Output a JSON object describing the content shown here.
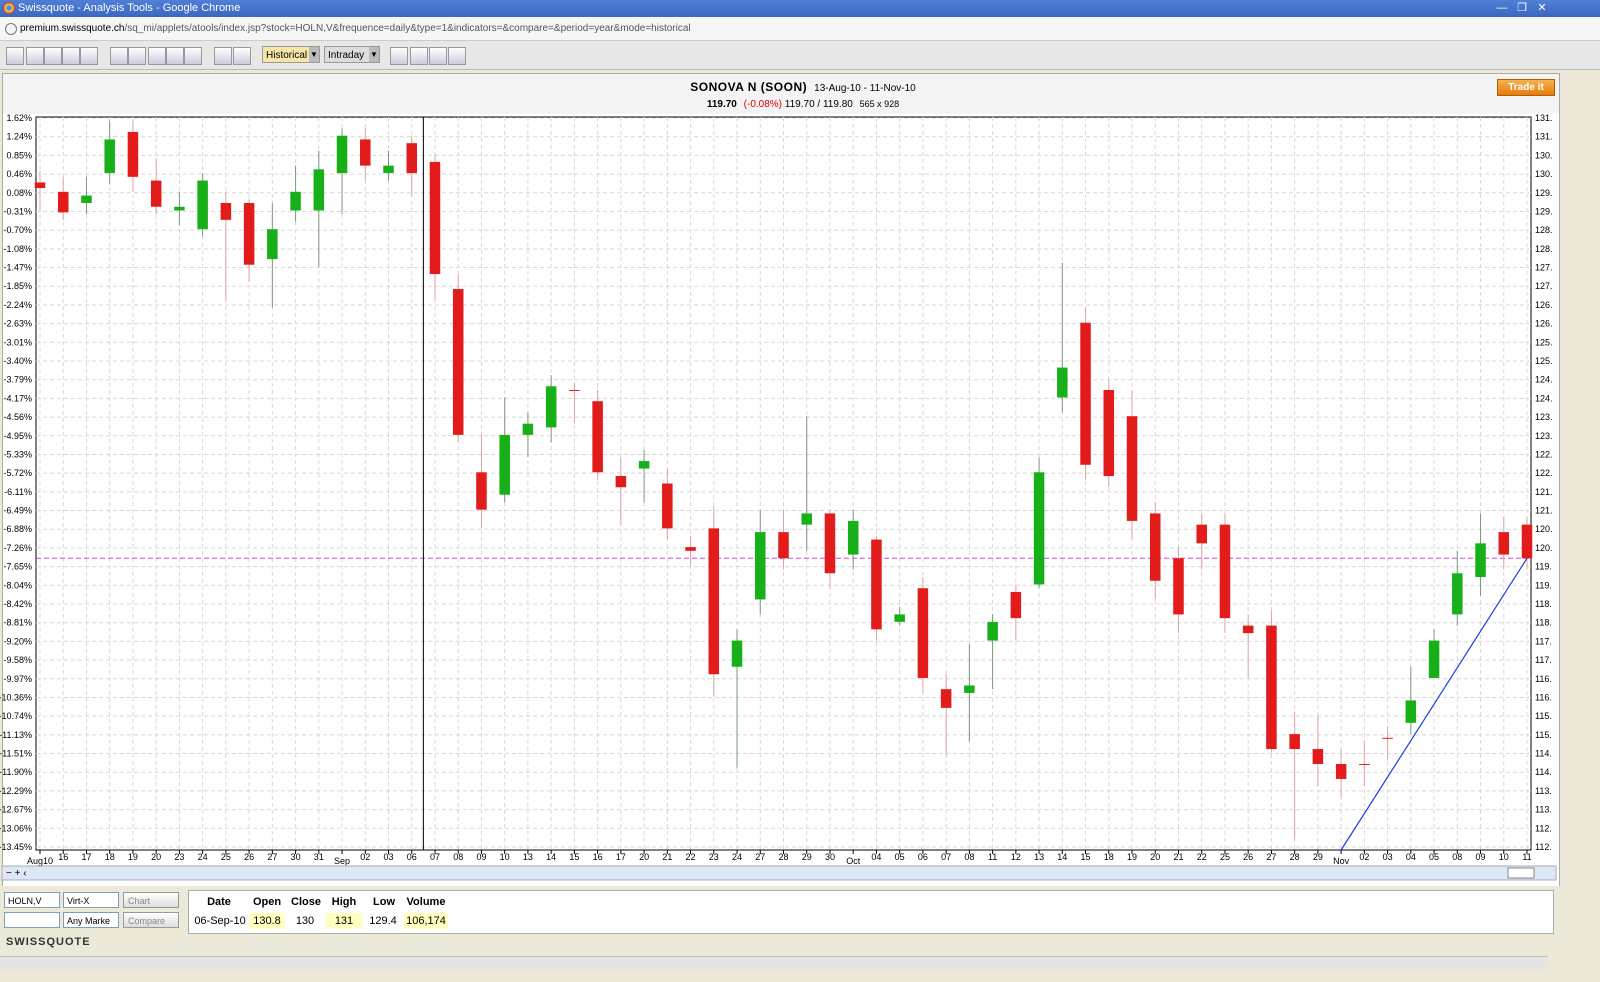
{
  "window": {
    "title": "Swissquote - Analysis Tools - Google Chrome",
    "url_host": "premium.swissquote.ch",
    "url_path": "/sq_mi/applets/atools/index.jsp?stock=HOLN,V&frequence=daily&type=1&indicators=&compare=&period=year&mode=historical"
  },
  "toolbar": {
    "mode_select": "Historical",
    "interval_select": "Intraday"
  },
  "header": {
    "name": "SONOVA N (SOON)",
    "range": "13-Aug-10 - 11-Nov-10",
    "last": "119.70",
    "change": "(-0.08%)",
    "bid": "119.70",
    "sep": "/",
    "ask": "119.80",
    "size": "565 x 928",
    "trade_button": "Trade it"
  },
  "chart_data": {
    "type": "candlestick",
    "title": "SONOVA N (SOON)",
    "y_left_ticks": [
      "1.62%",
      "1.24%",
      "0.85%",
      "0.46%",
      "0.08%",
      "-0.31%",
      "-0.70%",
      "-1.08%",
      "-1.47%",
      "-1.85%",
      "-2.24%",
      "-2.63%",
      "-3.01%",
      "-3.40%",
      "-3.79%",
      "-4.17%",
      "-4.56%",
      "-4.95%",
      "-5.33%",
      "-5.72%",
      "-6.11%",
      "-6.49%",
      "-6.88%",
      "-7.26%",
      "-7.65%",
      "-8.04%",
      "-8.42%",
      "-8.81%",
      "-9.20%",
      "-9.58%",
      "-9.97%",
      "-10.36%",
      "-10.74%",
      "-11.13%",
      "-11.51%",
      "-11.90%",
      "-12.29%",
      "-12.67%",
      "-13.06%",
      "-13.45%"
    ],
    "y_right_ticks": [
      "131.",
      "131.",
      "130.",
      "130.",
      "129.",
      "129.",
      "128.",
      "128.",
      "127.",
      "127.",
      "126.",
      "126.",
      "125.",
      "125.",
      "124.",
      "124.",
      "123.",
      "123.",
      "122.",
      "122.",
      "121.",
      "121.",
      "120.",
      "120.",
      "119.",
      "119.",
      "118.",
      "118.",
      "117.",
      "117.",
      "116.",
      "116.",
      "115.",
      "115.",
      "114.",
      "114.",
      "113.",
      "113.",
      "112.",
      "112."
    ],
    "ylim": [
      111.9,
      131.5
    ],
    "x_day_labels": [
      "Aug10",
      "16",
      "17",
      "18",
      "19",
      "20",
      "23",
      "24",
      "25",
      "26",
      "27",
      "30",
      "31",
      "Sep",
      "02",
      "03",
      "06",
      "07",
      "08",
      "09",
      "10",
      "13",
      "14",
      "15",
      "16",
      "17",
      "20",
      "21",
      "22",
      "23",
      "24",
      "27",
      "28",
      "29",
      "30",
      "Oct",
      "04",
      "05",
      "06",
      "07",
      "08",
      "11",
      "12",
      "13",
      "14",
      "15",
      "18",
      "19",
      "20",
      "21",
      "22",
      "25",
      "26",
      "27",
      "28",
      "29",
      "Nov",
      "02",
      "03",
      "04",
      "05",
      "08",
      "09",
      "10",
      "11"
    ],
    "cursor_index": 16,
    "reference_level": 119.7,
    "trendline": {
      "from": {
        "index": 56,
        "price": 111.9
      },
      "to": {
        "index": 64,
        "price": 119.7
      }
    },
    "candles": [
      {
        "o": 129.75,
        "c": 129.6,
        "h": 130.05,
        "l": 129.0
      },
      {
        "o": 129.5,
        "c": 128.95,
        "h": 129.9,
        "l": 128.75
      },
      {
        "o": 129.2,
        "c": 129.4,
        "h": 129.9,
        "l": 128.9
      },
      {
        "o": 130.0,
        "c": 130.9,
        "h": 131.4,
        "l": 129.7
      },
      {
        "o": 131.1,
        "c": 129.9,
        "h": 131.4,
        "l": 129.5
      },
      {
        "o": 129.8,
        "c": 129.1,
        "h": 130.4,
        "l": 128.9
      },
      {
        "o": 129.0,
        "c": 129.1,
        "h": 129.5,
        "l": 128.6
      },
      {
        "o": 128.5,
        "c": 129.8,
        "h": 130.0,
        "l": 128.3
      },
      {
        "o": 129.2,
        "c": 128.75,
        "h": 129.5,
        "l": 126.6
      },
      {
        "o": 129.2,
        "c": 127.55,
        "h": 129.3,
        "l": 127.1
      },
      {
        "o": 127.7,
        "c": 128.5,
        "h": 129.2,
        "l": 126.4
      },
      {
        "o": 129.0,
        "c": 129.5,
        "h": 130.2,
        "l": 128.7
      },
      {
        "o": 129.0,
        "c": 130.1,
        "h": 130.6,
        "l": 127.5
      },
      {
        "o": 130.0,
        "c": 131.0,
        "h": 131.2,
        "l": 128.9
      },
      {
        "o": 130.9,
        "c": 130.2,
        "h": 131.2,
        "l": 129.8
      },
      {
        "o": 130.0,
        "c": 130.2,
        "h": 130.6,
        "l": 129.8
      },
      {
        "o": 130.8,
        "c": 130.0,
        "h": 131.0,
        "l": 129.4
      },
      {
        "o": 130.3,
        "c": 127.3,
        "h": 130.5,
        "l": 126.6
      },
      {
        "o": 126.9,
        "c": 123.0,
        "h": 127.3,
        "l": 122.8
      },
      {
        "o": 122.0,
        "c": 121.0,
        "h": 123.0,
        "l": 120.5
      },
      {
        "o": 121.4,
        "c": 123.0,
        "h": 124.0,
        "l": 121.2
      },
      {
        "o": 123.0,
        "c": 123.3,
        "h": 123.6,
        "l": 122.4
      },
      {
        "o": 123.2,
        "c": 124.3,
        "h": 124.6,
        "l": 122.8
      },
      {
        "o": 124.2,
        "c": 124.2,
        "h": 124.4,
        "l": 123.3
      },
      {
        "o": 123.9,
        "c": 122.0,
        "h": 124.2,
        "l": 121.8
      },
      {
        "o": 121.9,
        "c": 121.6,
        "h": 122.4,
        "l": 120.6
      },
      {
        "o": 122.1,
        "c": 122.3,
        "h": 122.6,
        "l": 121.2
      },
      {
        "o": 121.7,
        "c": 120.5,
        "h": 122.1,
        "l": 120.2
      },
      {
        "o": 120.0,
        "c": 119.9,
        "h": 120.3,
        "l": 119.5
      },
      {
        "o": 120.5,
        "c": 116.6,
        "h": 121.1,
        "l": 116.0
      },
      {
        "o": 116.8,
        "c": 117.5,
        "h": 117.8,
        "l": 114.1
      },
      {
        "o": 118.6,
        "c": 120.4,
        "h": 121.0,
        "l": 118.2
      },
      {
        "o": 120.4,
        "c": 119.7,
        "h": 121.0,
        "l": 119.4
      },
      {
        "o": 120.6,
        "c": 120.9,
        "h": 123.5,
        "l": 119.9
      },
      {
        "o": 120.9,
        "c": 119.3,
        "h": 121.0,
        "l": 118.9
      },
      {
        "o": 119.8,
        "c": 120.7,
        "h": 121.0,
        "l": 119.4
      },
      {
        "o": 120.2,
        "c": 117.8,
        "h": 120.3,
        "l": 117.5
      },
      {
        "o": 118.0,
        "c": 118.2,
        "h": 118.4,
        "l": 117.9
      },
      {
        "o": 118.9,
        "c": 116.5,
        "h": 119.2,
        "l": 116.1
      },
      {
        "o": 116.2,
        "c": 115.7,
        "h": 116.6,
        "l": 114.4
      },
      {
        "o": 116.1,
        "c": 116.3,
        "h": 117.4,
        "l": 114.8
      },
      {
        "o": 117.5,
        "c": 118.0,
        "h": 118.2,
        "l": 116.2
      },
      {
        "o": 118.8,
        "c": 118.1,
        "h": 119.0,
        "l": 117.5
      },
      {
        "o": 119.0,
        "c": 122.0,
        "h": 122.4,
        "l": 118.9
      },
      {
        "o": 124.0,
        "c": 124.8,
        "h": 127.6,
        "l": 123.6
      },
      {
        "o": 126.0,
        "c": 122.2,
        "h": 126.4,
        "l": 121.8
      },
      {
        "o": 124.2,
        "c": 121.9,
        "h": 124.5,
        "l": 121.6
      },
      {
        "o": 123.5,
        "c": 120.7,
        "h": 124.2,
        "l": 120.2
      },
      {
        "o": 120.9,
        "c": 119.1,
        "h": 121.2,
        "l": 118.6
      },
      {
        "o": 119.7,
        "c": 118.2,
        "h": 120.0,
        "l": 117.7
      },
      {
        "o": 120.6,
        "c": 120.1,
        "h": 120.9,
        "l": 119.4
      },
      {
        "o": 120.6,
        "c": 118.1,
        "h": 120.9,
        "l": 117.7
      },
      {
        "o": 117.9,
        "c": 117.7,
        "h": 118.2,
        "l": 116.5
      },
      {
        "o": 117.9,
        "c": 114.6,
        "h": 118.3,
        "l": 114.5
      },
      {
        "o": 115.0,
        "c": 114.6,
        "h": 115.6,
        "l": 112.2
      },
      {
        "o": 114.6,
        "c": 114.2,
        "h": 115.5,
        "l": 113.6
      },
      {
        "o": 114.2,
        "c": 113.8,
        "h": 114.6,
        "l": 113.3
      },
      {
        "o": 114.2,
        "c": 114.2,
        "h": 114.8,
        "l": 113.6
      },
      {
        "o": 114.9,
        "c": 114.9,
        "h": 115.2,
        "l": 114.3
      },
      {
        "o": 115.3,
        "c": 115.9,
        "h": 116.8,
        "l": 115.0
      },
      {
        "o": 116.5,
        "c": 117.5,
        "h": 117.8,
        "l": 116.5
      },
      {
        "o": 118.2,
        "c": 119.3,
        "h": 119.9,
        "l": 117.9
      },
      {
        "o": 119.2,
        "c": 120.1,
        "h": 120.9,
        "l": 118.7
      },
      {
        "o": 120.4,
        "c": 119.8,
        "h": 120.8,
        "l": 119.4
      },
      {
        "o": 120.6,
        "c": 119.7,
        "h": 120.8,
        "l": 119.4
      }
    ]
  },
  "bottom": {
    "symbol_input": "HOLN,V",
    "exchange_select": "Virt-X",
    "chart_button": "Chart",
    "market_select": "Any Marke",
    "compare_button": "Compare",
    "logo": "SWISSQUOTE",
    "quote_headers": [
      "Date",
      "Open",
      "Close",
      "High",
      "Low",
      "Volume"
    ],
    "quote_values": [
      "06-Sep-10",
      "130.8",
      "130",
      "131",
      "129.4",
      "106,174"
    ]
  }
}
